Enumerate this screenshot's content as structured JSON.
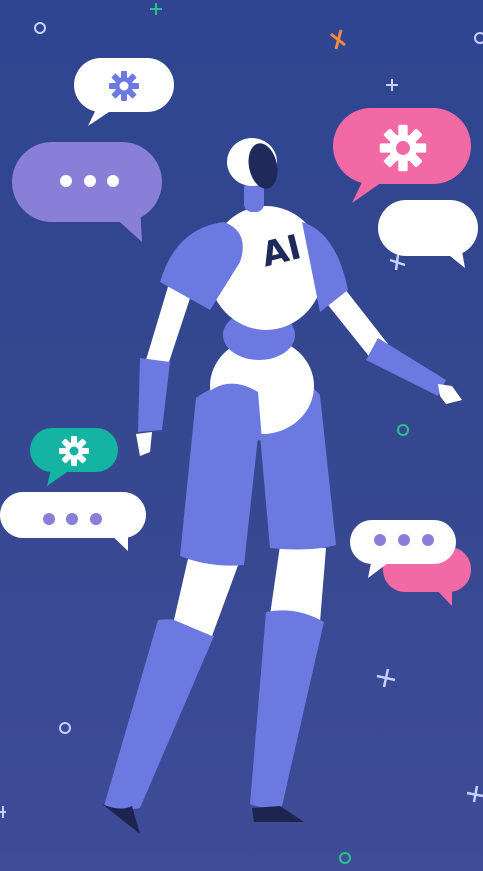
{
  "robot": {
    "chest_text": "AI",
    "body_color": "#6c79e0",
    "white": "#ffffff",
    "visor_color": "#1f2a5a",
    "dark": "#1d2450"
  },
  "bubbles": {
    "purple": "#8a7fd8",
    "pink": "#f26aa5",
    "teal": "#14b3a2",
    "white": "#ffffff",
    "dot_color": "#8a7fd8",
    "gear_color": "#6c79e0"
  },
  "icons": [
    "gear-icon",
    "ellipsis-icon"
  ],
  "accents": {
    "orange": "#f08a3c",
    "green": "#2bc18e",
    "light": "#c8d0ff"
  }
}
